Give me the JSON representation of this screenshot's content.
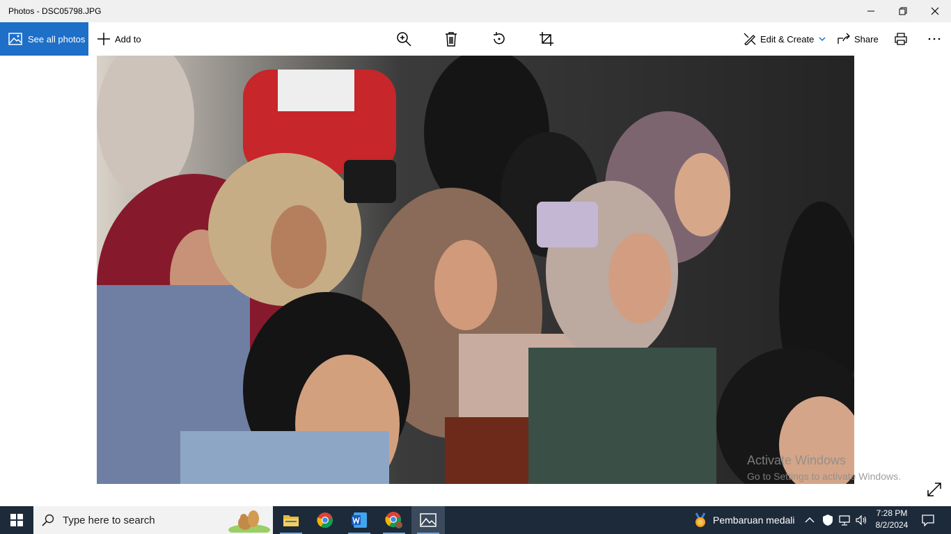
{
  "window": {
    "title": "Photos - DSC05798.JPG"
  },
  "toolbar": {
    "see_all_photos": "See all photos",
    "add_to": "Add to",
    "edit_create": "Edit & Create",
    "share": "Share"
  },
  "watermark": {
    "line1": "Activate Windows",
    "line2": "Go to Settings to activate Windows."
  },
  "taskbar": {
    "search_placeholder": "Type here to search",
    "notification": "Pembaruan medali",
    "time": "7:28 PM",
    "date": "8/2/2024"
  },
  "colors": {
    "accent": "#1e6fc8",
    "taskbar": "#1c2a3a",
    "titlebar": "#f0f0f0"
  }
}
